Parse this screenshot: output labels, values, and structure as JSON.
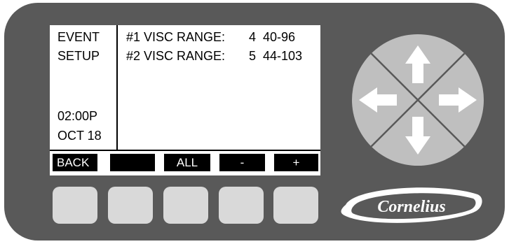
{
  "screen": {
    "menu_line1": "EVENT",
    "menu_line2": "SETUP",
    "time": "02:00P",
    "date": "OCT 18",
    "rows": [
      {
        "label": "#1 VISC RANGE:",
        "value": "4",
        "range": "40-96"
      },
      {
        "label": "#2 VISC RANGE:",
        "value": "5",
        "range": "44-103"
      }
    ]
  },
  "softkeys": [
    "BACK",
    "",
    "ALL",
    "-",
    "+"
  ],
  "nav_pad": {
    "icons": [
      "arrow-up-icon",
      "arrow-left-icon",
      "arrow-right-icon",
      "arrow-down-icon"
    ]
  },
  "logo": {
    "text": "Cornelius"
  },
  "colors": {
    "panel": "#595959",
    "buttons": "#d9d9d9",
    "nav": "#bfbfbf",
    "screen": "#ffffff"
  }
}
